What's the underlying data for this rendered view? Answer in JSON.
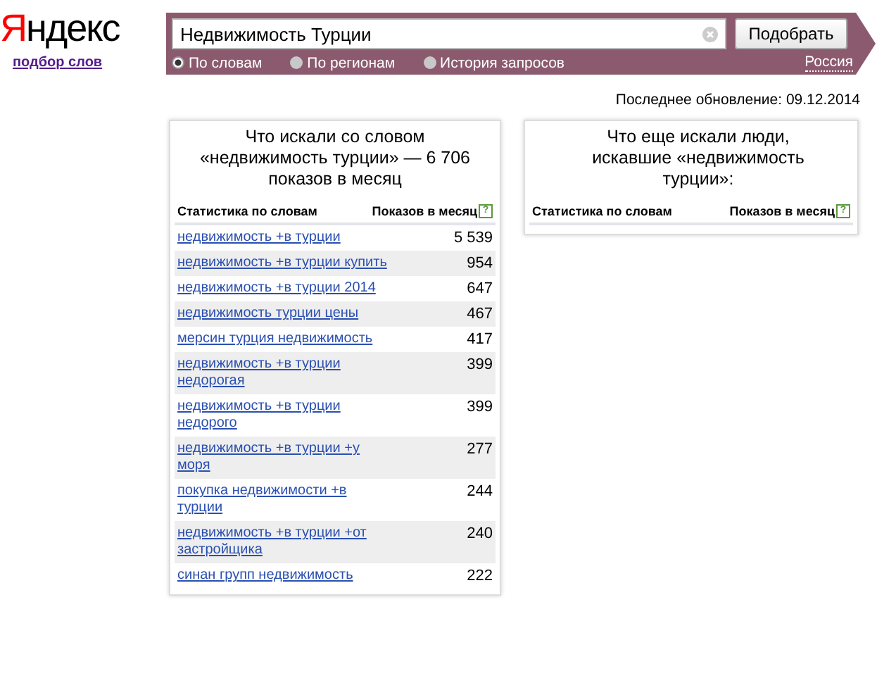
{
  "logo": "Яндекс",
  "service_link": "подбор слов",
  "search": {
    "value": "Недвижимость Турции",
    "button": "Подобрать",
    "modes": [
      {
        "label": "По словам",
        "selected": true
      },
      {
        "label": "По регионам",
        "selected": false
      },
      {
        "label": "История запросов",
        "selected": false
      }
    ],
    "region": "Россия"
  },
  "last_update": "Последнее обновление: 09.12.2014",
  "left_panel": {
    "title": "Что искали со словом «недвижимость турции» — 6 706 показов в месяц",
    "columns": [
      "Статистика по словам",
      "Показов в месяц"
    ],
    "help": "?",
    "rows": [
      {
        "phrase": "недвижимость +в турции",
        "count": "5 539"
      },
      {
        "phrase": "недвижимость +в турции купить",
        "count": "954"
      },
      {
        "phrase": "недвижимость +в турции 2014",
        "count": "647"
      },
      {
        "phrase": "недвижимость турции цены",
        "count": "467"
      },
      {
        "phrase": "мерсин турция недвижимость",
        "count": "417"
      },
      {
        "phrase": "недвижимость +в турции недорогая",
        "count": "399"
      },
      {
        "phrase": "недвижимость +в турции недорого",
        "count": "399"
      },
      {
        "phrase": "недвижимость +в турции +у моря",
        "count": "277"
      },
      {
        "phrase": "покупка недвижимости +в турции",
        "count": "244"
      },
      {
        "phrase": "недвижимость +в турции +от застройщика",
        "count": "240"
      },
      {
        "phrase": "синан групп недвижимость",
        "count": "222"
      }
    ]
  },
  "right_panel": {
    "title": "Что еще искали люди, искавшие «недвижимость турции»:",
    "columns": [
      "Статистика по словам",
      "Показов в месяц"
    ],
    "help": "?"
  }
}
